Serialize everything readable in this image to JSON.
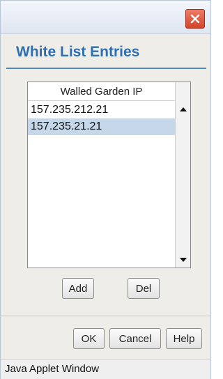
{
  "dialog": {
    "title": "White List Entries",
    "close_icon": "close-icon"
  },
  "table": {
    "column_header": "Walled Garden IP",
    "rows": [
      "157.235.212.21",
      "157.235.21.21"
    ],
    "selected_row": 1
  },
  "buttons": {
    "add": "Add",
    "del": "Del",
    "ok": "OK",
    "cancel": "Cancel",
    "help": "Help"
  },
  "status_bar": {
    "text": "Java Applet Window"
  },
  "colors": {
    "title": "#2f6fb0",
    "accent_line": "#4f86c6",
    "selection": "#c6d7ea",
    "close_button": "#d2442c"
  }
}
